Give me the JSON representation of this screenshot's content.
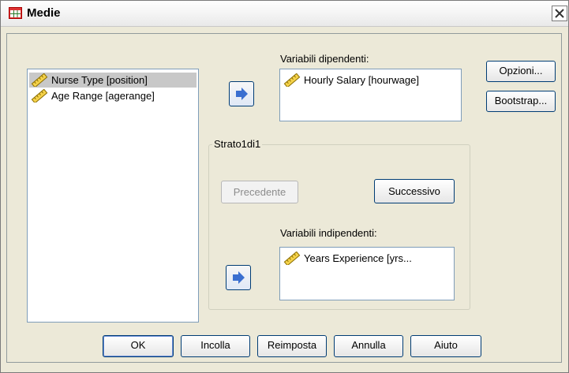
{
  "window": {
    "title": "Medie"
  },
  "source_list": {
    "items": [
      {
        "label": "Nurse Type [position]",
        "icon": "ruler-icon",
        "selected": true
      },
      {
        "label": "Age Range [agerange]",
        "icon": "ruler-icon",
        "selected": false
      }
    ]
  },
  "dependent": {
    "label": "Variabili dipendenti:",
    "items": [
      {
        "label": "Hourly Salary [hourwage]",
        "icon": "ruler-icon"
      }
    ]
  },
  "layer": {
    "title": "Strato1di1",
    "previous_label": "Precedente",
    "next_label": "Successivo",
    "independent_label": "Variabili indipendenti:",
    "items": [
      {
        "label": "Years Experience [yrs...",
        "icon": "ruler-icon"
      }
    ]
  },
  "side_buttons": {
    "options_label": "Opzioni...",
    "bootstrap_label": "Bootstrap..."
  },
  "bottom_buttons": {
    "ok_label": "OK",
    "paste_label": "Incolla",
    "reset_label": "Reimposta",
    "cancel_label": "Annulla",
    "help_label": "Aiuto"
  },
  "colors": {
    "arrow": "#3a6fd0",
    "selection": "#c8c8c8",
    "window_bg": "#ece9d8"
  }
}
